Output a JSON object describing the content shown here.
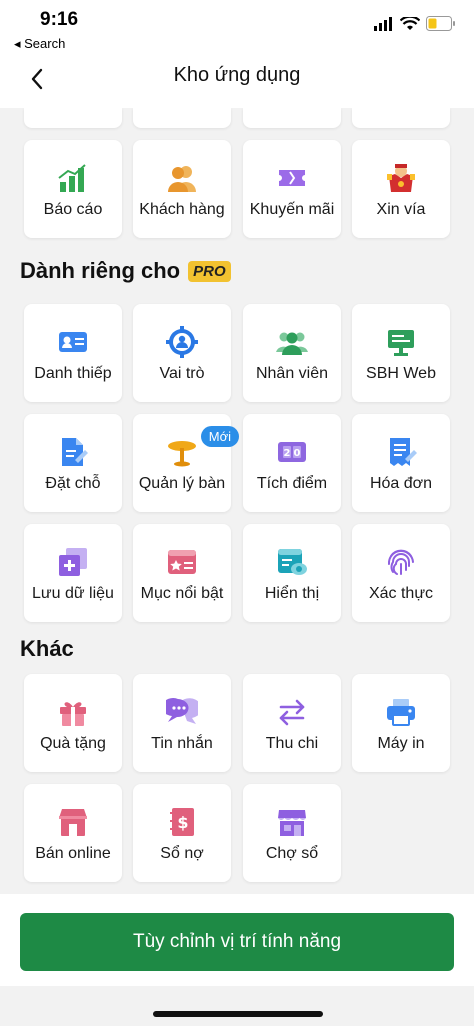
{
  "status": {
    "time": "9:16",
    "back_label": "◂ Search"
  },
  "nav": {
    "title": "Kho ứng dụng"
  },
  "sections": {
    "top_row": [
      {
        "label": "Báo cáo",
        "icon": "bar-chart-icon"
      },
      {
        "label": "Khách hàng",
        "icon": "customers-icon"
      },
      {
        "label": "Khuyến mãi",
        "icon": "ticket-icon"
      },
      {
        "label": "Xin vía",
        "icon": "god-of-wealth-icon"
      }
    ],
    "pro": {
      "title": "Dành riêng cho",
      "badge": "PRO",
      "items": [
        {
          "label": "Danh thiếp",
          "icon": "business-card-icon"
        },
        {
          "label": "Vai trò",
          "icon": "role-gear-icon"
        },
        {
          "label": "Nhân viên",
          "icon": "employees-icon"
        },
        {
          "label": "SBH Web",
          "icon": "web-monitor-icon"
        },
        {
          "label": "Đặt chỗ",
          "icon": "booking-document-icon"
        },
        {
          "label": "Quản lý bàn",
          "icon": "table-icon",
          "badge": "Mới"
        },
        {
          "label": "Tích điểm",
          "icon": "points-icon"
        },
        {
          "label": "Hóa đơn",
          "icon": "invoice-icon"
        },
        {
          "label": "Lưu dữ liệu",
          "icon": "save-data-icon"
        },
        {
          "label": "Mục nổi bật",
          "icon": "featured-icon"
        },
        {
          "label": "Hiển thị",
          "icon": "display-eye-icon"
        },
        {
          "label": "Xác thực",
          "icon": "fingerprint-icon"
        }
      ]
    },
    "other": {
      "title": "Khác",
      "items": [
        {
          "label": "Quà tặng",
          "icon": "gift-icon"
        },
        {
          "label": "Tin nhắn",
          "icon": "chat-icon"
        },
        {
          "label": "Thu chi",
          "icon": "transfer-arrows-icon"
        },
        {
          "label": "Máy in",
          "icon": "printer-icon"
        },
        {
          "label": "Bán online",
          "icon": "online-store-icon"
        },
        {
          "label": "Sổ nợ",
          "icon": "debt-book-icon"
        },
        {
          "label": "Chợ sổ",
          "icon": "market-icon"
        }
      ]
    }
  },
  "cta": {
    "label": "Tùy chỉnh vị trí tính năng"
  }
}
